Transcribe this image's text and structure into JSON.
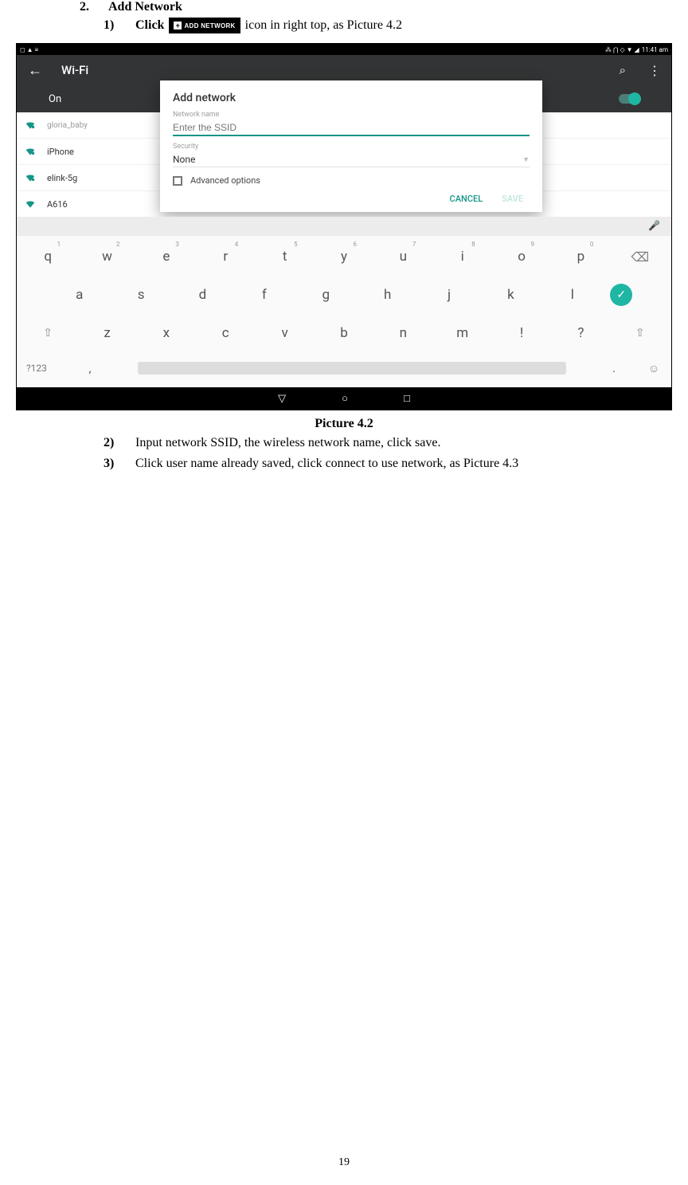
{
  "doc": {
    "section_num": "2.",
    "section_title": "Add Network",
    "step1_marker": "1)",
    "step1_a": "Click",
    "step1_b": "icon in right top, as Picture 4.2",
    "add_btn": "ADD NETWORK",
    "caption": "Picture 4.2",
    "step2_marker": "2)",
    "step2": "Input network SSID, the wireless network name, click save.",
    "step3_marker": "3)",
    "step3": "Click user name already saved, click connect to use network, as Picture 4.3",
    "page_number": "19"
  },
  "status": {
    "left_icons": "◻ ▲ ≡",
    "right_icons": "⁂ ⋂ ◇ ▼ ◢",
    "time": "11:41 am"
  },
  "appbar": {
    "title": "Wi-Fi"
  },
  "wifi": {
    "on_label": "On",
    "networks": [
      "gloria_baby",
      "iPhone",
      "elink-5g",
      "A616"
    ]
  },
  "dialog": {
    "title": "Add network",
    "name_label": "Network name",
    "ssid_placeholder": "Enter the SSID",
    "security_label": "Security",
    "security_value": "None",
    "advanced": "Advanced options",
    "cancel": "CANCEL",
    "save": "SAVE"
  },
  "keyboard": {
    "row1": [
      {
        "k": "q",
        "h": "1"
      },
      {
        "k": "w",
        "h": "2"
      },
      {
        "k": "e",
        "h": "3"
      },
      {
        "k": "r",
        "h": "4"
      },
      {
        "k": "t",
        "h": "5"
      },
      {
        "k": "y",
        "h": "6"
      },
      {
        "k": "u",
        "h": "7"
      },
      {
        "k": "i",
        "h": "8"
      },
      {
        "k": "o",
        "h": "9"
      },
      {
        "k": "p",
        "h": "0"
      }
    ],
    "row2": [
      "a",
      "s",
      "d",
      "f",
      "g",
      "h",
      "j",
      "k",
      "l"
    ],
    "row3": [
      "z",
      "x",
      "c",
      "v",
      "b",
      "n",
      "m",
      "!",
      "?"
    ],
    "symbols": "?123",
    "comma": ",",
    "period": "."
  }
}
